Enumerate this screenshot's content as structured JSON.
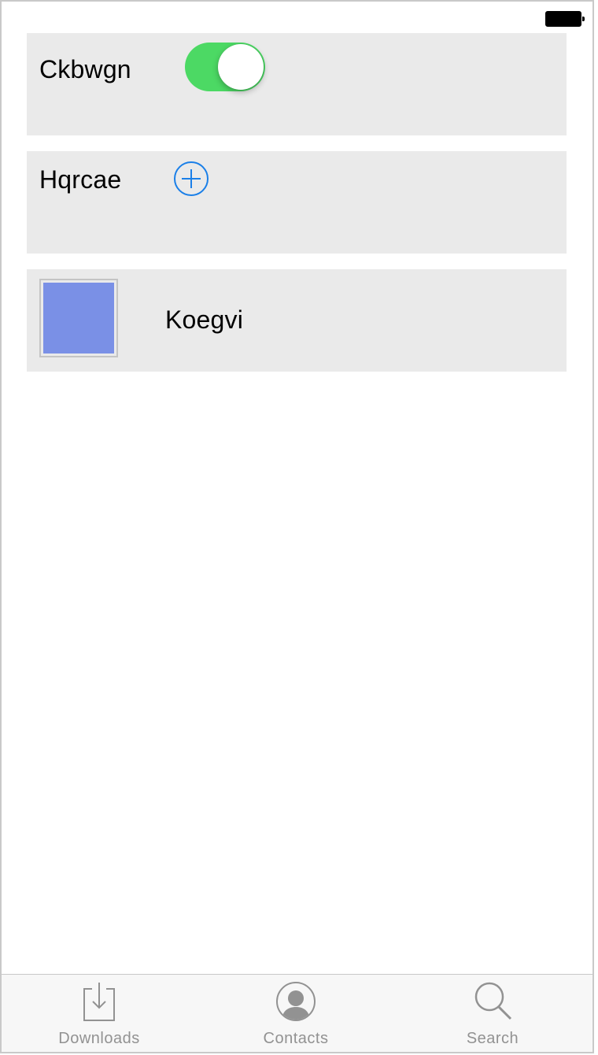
{
  "status_bar": {
    "battery_icon": "battery-full-icon"
  },
  "rows": [
    {
      "label": "Ckbwgn",
      "control": "toggle",
      "toggle_on": true,
      "toggle_color": "#4cd964"
    },
    {
      "label": "Hqrcae",
      "control": "add-button",
      "icon": "plus-circle-icon",
      "icon_color": "#1a7fe8"
    },
    {
      "label": "Koegvi",
      "control": "thumbnail",
      "thumb_color": "#7a90e6"
    }
  ],
  "tabbar": {
    "tabs": [
      {
        "label": "Downloads",
        "icon": "download-icon"
      },
      {
        "label": "Contacts",
        "icon": "contact-icon"
      },
      {
        "label": "Search",
        "icon": "search-icon"
      }
    ]
  },
  "colors": {
    "row_background": "#eaeaea",
    "tab_label": "#929292"
  }
}
